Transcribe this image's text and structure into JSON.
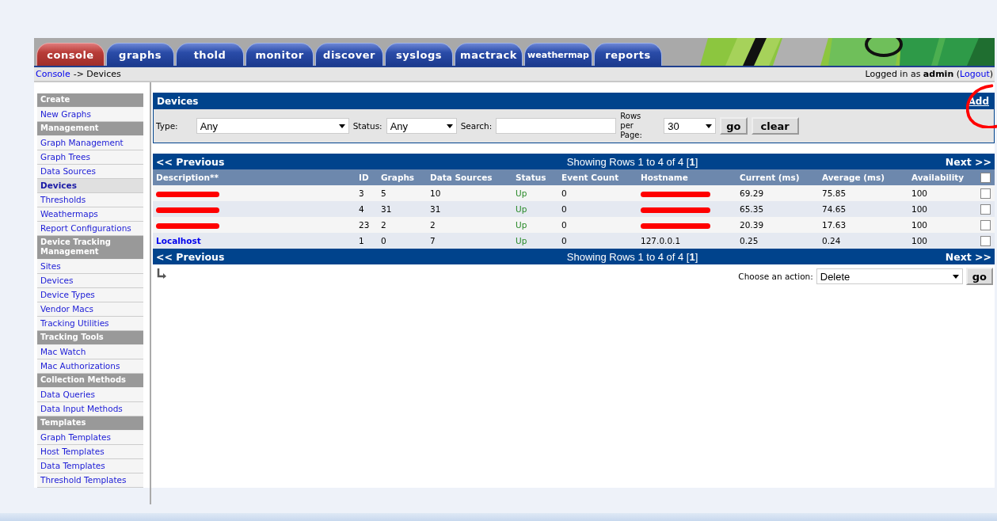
{
  "tabs": [
    {
      "label": "console",
      "selected": true
    },
    {
      "label": "graphs",
      "selected": false
    },
    {
      "label": "thold",
      "selected": false
    },
    {
      "label": "monitor",
      "selected": false
    },
    {
      "label": "discover",
      "selected": false
    },
    {
      "label": "syslogs",
      "selected": false
    },
    {
      "label": "mactrack",
      "selected": false
    },
    {
      "label": "weathermap",
      "selected": false
    },
    {
      "label": "reports",
      "selected": false
    }
  ],
  "breadcrumb": {
    "link": "Console",
    "rest": "-> Devices"
  },
  "login": {
    "text": "Logged in as **admin** (",
    "logout": "Logout",
    "close": ")"
  },
  "sidebar": [
    {
      "header": "Create",
      "items": [
        {
          "label": "New Graphs",
          "selected": false
        }
      ]
    },
    {
      "header": "Management",
      "items": [
        {
          "label": "Graph Management",
          "selected": false
        },
        {
          "label": "Graph Trees",
          "selected": false
        },
        {
          "label": "Data Sources",
          "selected": false
        },
        {
          "label": "Devices",
          "selected": true
        },
        {
          "label": "Thresholds",
          "selected": false
        },
        {
          "label": "Weathermaps",
          "selected": false
        },
        {
          "label": "Report Configurations",
          "selected": false
        }
      ]
    },
    {
      "header": "Device Tracking Management",
      "items": [
        {
          "label": "Sites",
          "selected": false
        },
        {
          "label": "Devices",
          "selected": false
        },
        {
          "label": "Device Types",
          "selected": false
        },
        {
          "label": "Vendor Macs",
          "selected": false
        },
        {
          "label": "Tracking Utilities",
          "selected": false
        }
      ]
    },
    {
      "header": "Tracking Tools",
      "items": [
        {
          "label": "Mac Watch",
          "selected": false
        },
        {
          "label": "Mac Authorizations",
          "selected": false
        }
      ]
    },
    {
      "header": "Collection Methods",
      "items": [
        {
          "label": "Data Queries",
          "selected": false
        },
        {
          "label": "Data Input Methods",
          "selected": false
        }
      ]
    },
    {
      "header": "Templates",
      "items": [
        {
          "label": "Graph Templates",
          "selected": false
        },
        {
          "label": "Host Templates",
          "selected": false
        },
        {
          "label": "Data Templates",
          "selected": false
        },
        {
          "label": "Threshold Templates",
          "selected": false
        }
      ]
    }
  ],
  "filter": {
    "title": "Devices",
    "add": "Add",
    "type_label": "Type:",
    "type_value": "Any",
    "status_label": "Status:",
    "status_value": "Any",
    "search_label": "Search:",
    "rows_label": "Rows per Page:",
    "rows_value": "30",
    "go": "go",
    "clear": "clear"
  },
  "pagers": [
    {
      "previous": "<< Previous",
      "showing": "Showing Rows 1 to 4 of 4 [**1**]",
      "next": "Next >>"
    },
    {
      "previous": "<< Previous",
      "showing": "Showing Rows 1 to 4 of 4 [**1**]",
      "next": "Next >>"
    }
  ],
  "table": {
    "columns": [
      "Description**",
      "ID",
      "Graphs",
      "Data Sources",
      "Status",
      "Event Count",
      "Hostname",
      "Current (ms)",
      "Average (ms)",
      "Availability"
    ],
    "all_checked": false,
    "rows": [
      {
        "description_redacted": true,
        "id": "3",
        "graphs": "5",
        "data_sources": "10",
        "status": "Up",
        "event_count": "0",
        "hostname_redacted": true,
        "current": "69.29",
        "average": "75.85",
        "availability": "100",
        "checked": false
      },
      {
        "description_redacted": true,
        "id": "4",
        "graphs": "31",
        "data_sources": "31",
        "status": "Up",
        "event_count": "0",
        "hostname_redacted": true,
        "current": "65.35",
        "average": "74.65",
        "availability": "100",
        "checked": false
      },
      {
        "description_redacted": true,
        "id": "23",
        "graphs": "2",
        "data_sources": "2",
        "status": "Up",
        "event_count": "0",
        "hostname_redacted": true,
        "current": "20.39",
        "average": "17.63",
        "availability": "100",
        "checked": false
      },
      {
        "description": "Localhost",
        "description_redacted": false,
        "id": "1",
        "graphs": "0",
        "data_sources": "7",
        "status": "Up",
        "event_count": "0",
        "hostname": "127.0.0.1",
        "hostname_redacted": false,
        "current": "0.25",
        "average": "0.24",
        "availability": "100",
        "checked": false
      }
    ]
  },
  "action": {
    "label": "Choose an action:",
    "value": "Delete",
    "go": "go"
  }
}
